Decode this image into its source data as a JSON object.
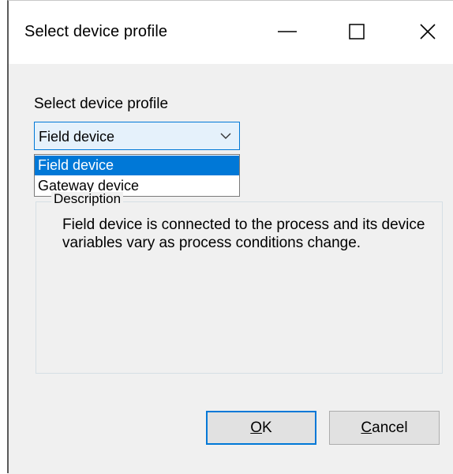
{
  "window": {
    "title": "Select device profile",
    "controls": {
      "minimize_icon": "minimize-icon",
      "maximize_icon": "maximize-icon",
      "close_icon": "close-icon"
    }
  },
  "form": {
    "profile_label": "Select device profile",
    "combo": {
      "selected": "Field device",
      "arrow_icon": "chevron-down-icon",
      "options": [
        "Field device",
        "Gateway device"
      ],
      "highlighted_index": 0
    },
    "description_group": {
      "title": "Description",
      "text": "Field device is connected to the process and its device variables vary as process conditions change."
    }
  },
  "buttons": {
    "ok": {
      "mnemonic": "O",
      "rest": "K"
    },
    "cancel": {
      "mnemonic": "C",
      "rest": "ancel"
    }
  },
  "colors": {
    "accent": "#0078d7",
    "combo_bg": "#e5f1fb",
    "dialog_bg": "#f0f0f0",
    "title_bg": "#ffffff"
  }
}
